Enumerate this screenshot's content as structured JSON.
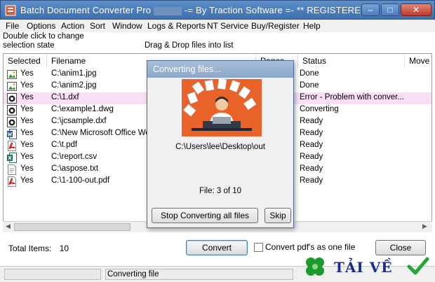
{
  "window": {
    "title": "Batch Document Converter Pro",
    "title_suffix": " -= By Traction Software =- ** REGISTERED **",
    "minimize_glyph": "–",
    "maximize_glyph": "□",
    "close_glyph": "✕"
  },
  "menu": [
    "File",
    "Options",
    "Action",
    "Sort",
    "Window",
    "Logs & Reports",
    "NT Service",
    "Buy/Register",
    "Help"
  ],
  "hints": {
    "selection": "Double click to change\nselection state",
    "drag_drop": "Drag & Drop files into list"
  },
  "columns": {
    "selected": "Selected",
    "filename": "Filename",
    "pages": "Pages",
    "status": "Status",
    "move": "Move T"
  },
  "files": [
    {
      "selected": "Yes",
      "filename": "C:\\anim1.jpg",
      "status": "Done",
      "icon": "image-file-icon"
    },
    {
      "selected": "Yes",
      "filename": "C:\\anim2.jpg",
      "status": "Done",
      "icon": "image-file-icon"
    },
    {
      "selected": "Yes",
      "filename": "C:\\1.dxf",
      "status": "Error - Problem with conver...",
      "icon": "cad-file-icon"
    },
    {
      "selected": "Yes",
      "filename": "C:\\example1.dwg",
      "status": "Converting",
      "icon": "cad-file-icon"
    },
    {
      "selected": "Yes",
      "filename": "C:\\jcsample.dxf",
      "status": "Ready",
      "icon": "cad-file-icon"
    },
    {
      "selected": "Yes",
      "filename": "C:\\New Microsoft Office Wor",
      "status": "Ready",
      "icon": "word-file-icon"
    },
    {
      "selected": "Yes",
      "filename": "C:\\t.pdf",
      "status": "Ready",
      "icon": "pdf-file-icon"
    },
    {
      "selected": "Yes",
      "filename": "C:\\report.csv",
      "status": "Ready",
      "icon": "excel-file-icon"
    },
    {
      "selected": "Yes",
      "filename": "C:\\aspose.txt",
      "status": "Ready",
      "icon": "text-file-icon"
    },
    {
      "selected": "Yes",
      "filename": "C:\\1-100-out.pdf",
      "status": "Ready",
      "icon": "pdf-file-icon"
    }
  ],
  "footer": {
    "total_label": "Total Items:",
    "total_value": "10",
    "convert_button": "Convert",
    "pdf_option": "Convert pdf's as one file",
    "pdf_option_checked": false,
    "close_button": "Close"
  },
  "statusbar": {
    "message": "Converting file"
  },
  "dialog": {
    "title": "Converting files...",
    "path": "C:\\Users\\lee\\Desktop\\out",
    "progress_text": "File: 3 of 10",
    "stop_button": "Stop Converting all files",
    "skip_button": "Skip",
    "illustration": "person-at-laptop-with-documents",
    "illustration_bg": "#e8622a"
  },
  "watermark": {
    "text": "TẢI VỀ",
    "color": "#1a2d8f"
  },
  "colors": {
    "error_row": "#f9dff6",
    "title_bar": "#4a7dbd"
  }
}
